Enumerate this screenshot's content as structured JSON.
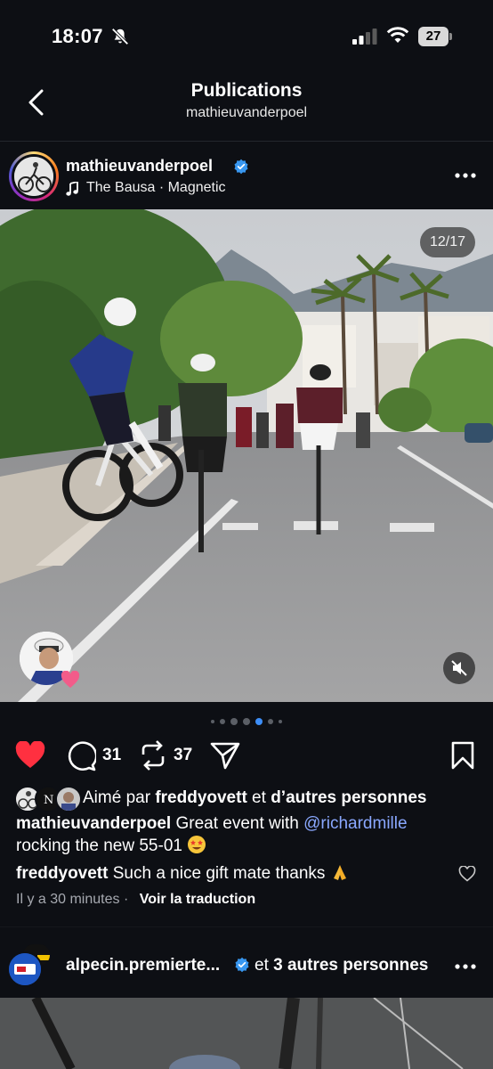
{
  "status_bar": {
    "time": "18:07",
    "battery": "27",
    "icons": [
      "bell-slash-icon",
      "signal-icon",
      "wifi-icon",
      "battery-icon"
    ]
  },
  "nav": {
    "title": "Publications",
    "subtitle": "mathieuvanderpoel",
    "back_icon": "chevron-left-icon"
  },
  "post": {
    "username": "mathieuvanderpoel",
    "verified": true,
    "music": "The Bausa · Magnetic",
    "image_counter": "12/17",
    "carousel_dots": 7,
    "carousel_active_index": 4,
    "like_count": "31",
    "repost_count": "37",
    "liked": true,
    "likes_prefix": "Aimé par ",
    "likes_user": "freddyovett",
    "likes_mid": " et ",
    "likes_suffix": "d’autres personnes",
    "caption_user": "mathieuvanderpoel",
    "caption_text_1": " Great event with ",
    "caption_mention": "@richardmille",
    "caption_text_2": "rocking the new 55-01 ",
    "comment_user": "freddyovett",
    "comment_text": " Such a nice gift mate thanks ",
    "time_ago": "Il y a 30 minutes",
    "time_sep": " · ",
    "translate_label": "Voir la traduction"
  },
  "post2": {
    "username": "alpecin.premierte...",
    "verified": true,
    "others_prefix": "et ",
    "others": "3 autres personnes"
  },
  "colors": {
    "background": "#0d0f14",
    "like_red": "#ff3040",
    "verified_blue": "#3897f0",
    "mention_blue": "#8aa8ff",
    "dot_active": "#3d8ef7"
  }
}
